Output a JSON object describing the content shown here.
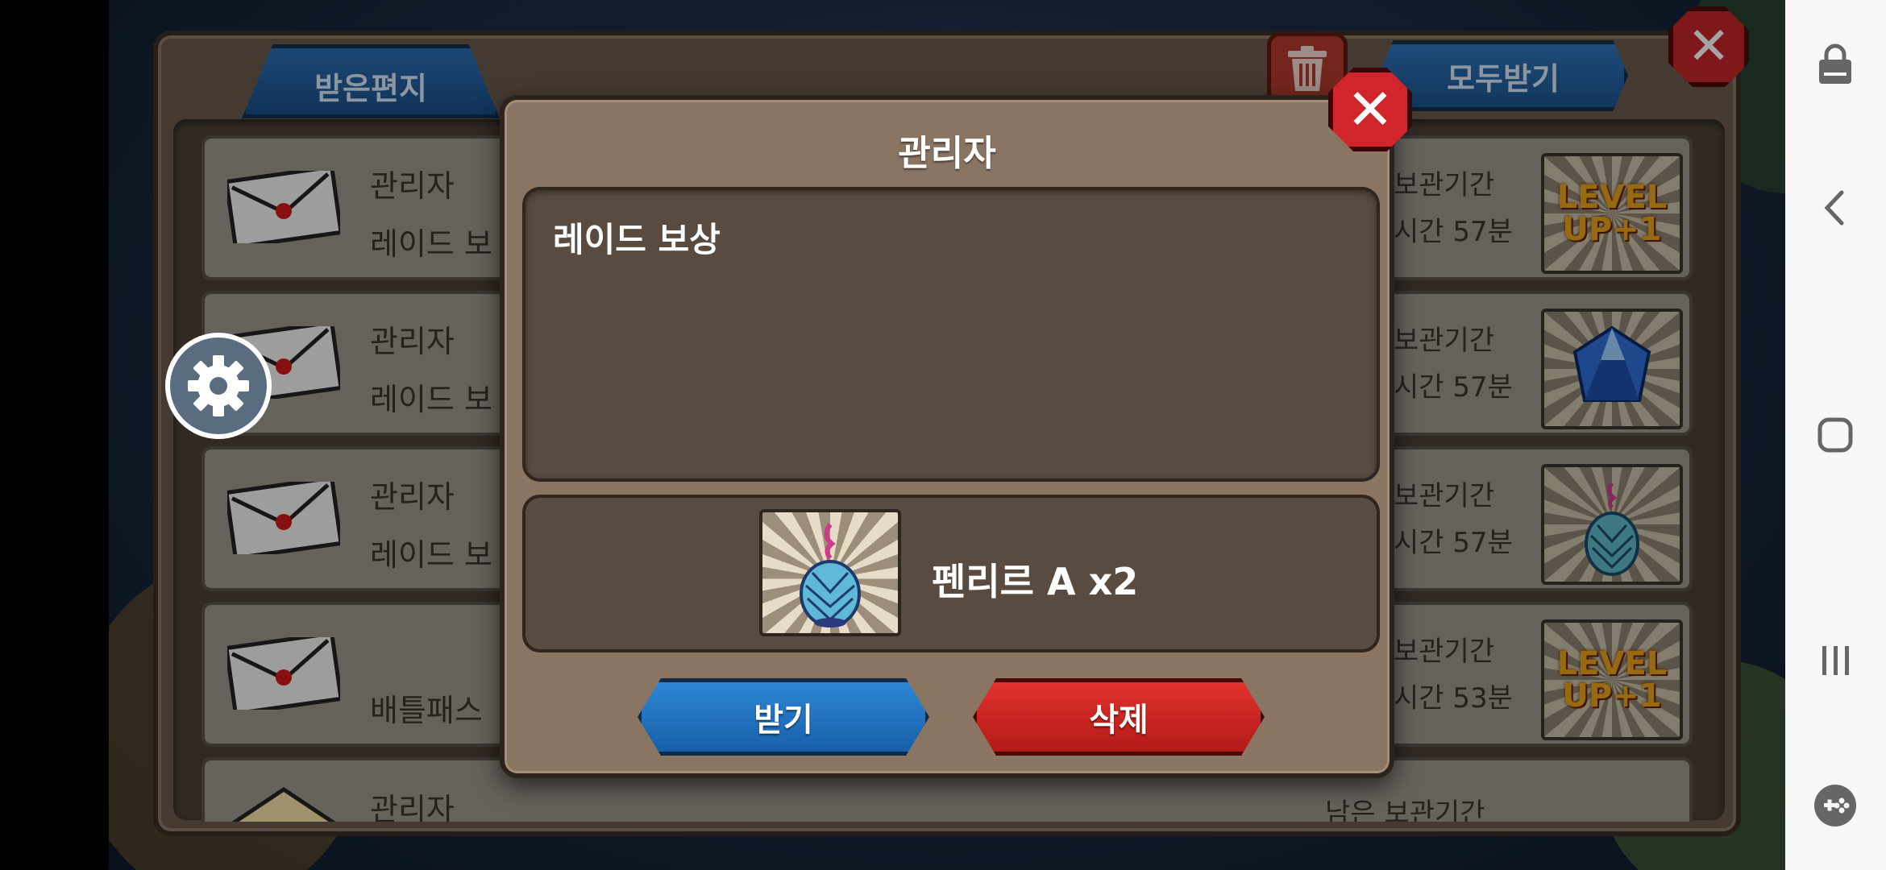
{
  "mailbox": {
    "tab_received": "받은편지",
    "claim_all": "모두받기",
    "rows": [
      {
        "sender": "관리자",
        "subject": "레이드 보",
        "period": "보관기간",
        "time": "시간 57분",
        "thumb": "LEVEL UP+1"
      },
      {
        "sender": "관리자",
        "subject": "레이드 보",
        "period": "보관기간",
        "time": "시간 57분",
        "thumb": "crystal-icon"
      },
      {
        "sender": "관리자",
        "subject": "레이드 보",
        "period": "보관기간",
        "time": "시간 57분",
        "thumb": "pine-cone-icon"
      },
      {
        "sender": "",
        "subject": "배틀패스",
        "period": "보관기간",
        "time": "시간 53분",
        "thumb": "LEVEL UP+1"
      },
      {
        "sender": "관리자",
        "subject": "",
        "period": "남은 보관기간",
        "time": "",
        "thumb": ""
      }
    ]
  },
  "modal": {
    "title": "관리자",
    "message": "레이드 보상",
    "reward_text": "펜리르 A x2",
    "claim_button": "받기",
    "delete_button": "삭제"
  },
  "colors": {
    "accent_blue": "#1760a8",
    "accent_red": "#b21a18",
    "panel_brown": "#8a7563"
  },
  "navbar_icons": [
    "lock-screen-icon",
    "back-icon",
    "home-icon",
    "recents-icon",
    "game-tools-icon"
  ]
}
